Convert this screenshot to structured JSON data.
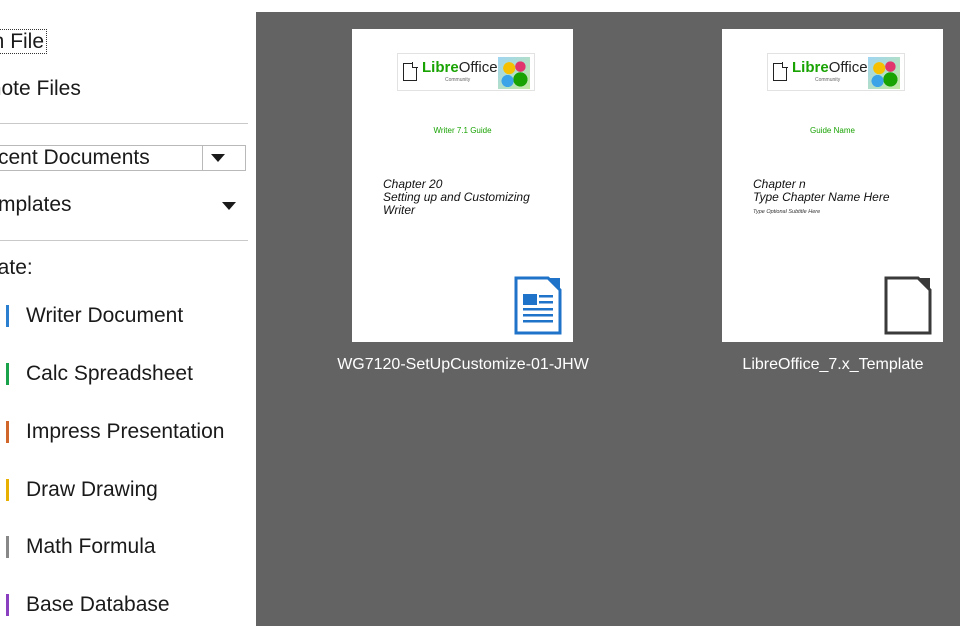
{
  "sidebar": {
    "open_file": "en File",
    "remote_files": "mote Files",
    "recent_documents": "cent Documents",
    "templates": "mplates",
    "create_label": "eate:",
    "create_items": [
      {
        "label": "Writer Document",
        "accent": "#2a7fd0"
      },
      {
        "label": "Calc Spreadsheet",
        "accent": "#1aa24a"
      },
      {
        "label": "Impress Presentation",
        "accent": "#d0662a"
      },
      {
        "label": "Draw Drawing",
        "accent": "#e8b000"
      },
      {
        "label": "Math Formula",
        "accent": "#888888"
      },
      {
        "label": "Base Database",
        "accent": "#8a3fc0"
      }
    ]
  },
  "thumbnails": [
    {
      "logo_text_bold": "Libre",
      "logo_text": "Office",
      "logo_sub": "Community",
      "guide_name": "Writer 7.1 Guide",
      "chapter_line1": "Chapter 20",
      "chapter_line2": "Setting up and Customizing",
      "chapter_line3": "Writer",
      "subtitle": "",
      "caption": "WG7120-SetUpCustomize-01-JHW",
      "icon": "writer-document-icon"
    },
    {
      "logo_text_bold": "Libre",
      "logo_text": "Office",
      "logo_sub": "Community",
      "guide_name": "Guide Name",
      "chapter_line1": "Chapter n",
      "chapter_line2": "Type Chapter Name Here",
      "chapter_line3": "",
      "subtitle": "Type Optional Subtitle Here",
      "caption": "LibreOffice_7.x_Template",
      "icon": "generic-document-icon"
    }
  ],
  "colors": {
    "main_background": "#636363",
    "accent_green": "#18a303",
    "writer_blue": "#1f73c8"
  }
}
